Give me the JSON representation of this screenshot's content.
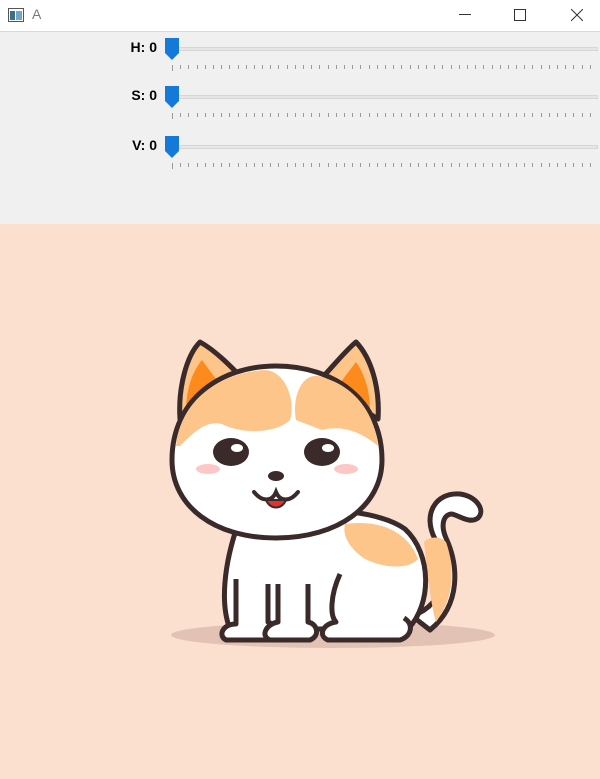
{
  "window": {
    "title": "A",
    "icons": [
      "app-icon",
      "minimize-icon",
      "maximize-icon",
      "close-icon"
    ]
  },
  "sliders": [
    {
      "label": "H: 0",
      "value": 0
    },
    {
      "label": "S: 0",
      "value": 0
    },
    {
      "label": "V: 0",
      "value": 0
    }
  ],
  "colors": {
    "slider_thumb": "#1479d9",
    "panel_bg": "#f0f0f0",
    "image_bg": "#fbdfcf",
    "cat_orange": "#fdc58a",
    "cat_ear": "#fd8a1c",
    "outline": "#3a2a2a"
  },
  "image": {
    "subject": "cartoon-cat"
  }
}
